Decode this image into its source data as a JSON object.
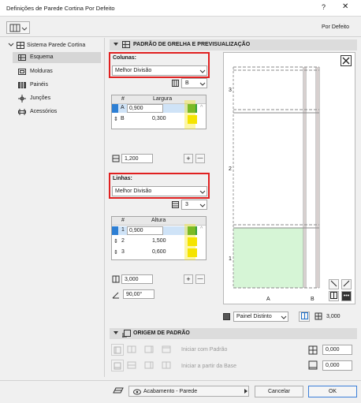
{
  "window": {
    "title": "Definições de Parede Cortina Por Defeito",
    "help": "?",
    "close": "✕"
  },
  "header": {
    "mode": "Por Defeito"
  },
  "sidebar": {
    "root": "Sistema Parede Cortina",
    "items": [
      {
        "label": "Esquema"
      },
      {
        "label": "Molduras"
      },
      {
        "label": "Painéis"
      },
      {
        "label": "Junções"
      },
      {
        "label": "Acessórios"
      }
    ]
  },
  "section_grid": {
    "title": "PADRÃO DE GRELHA E PREVISUALIZAÇÃO"
  },
  "columns": {
    "label": "Colunas:",
    "mode": "Melhor Divisão",
    "ref": "B",
    "table": {
      "hash": "#",
      "header": "Largura",
      "rows": [
        {
          "id": "A",
          "value": "0,900"
        },
        {
          "id": "B",
          "value": "0,300"
        }
      ]
    },
    "total": "1,200",
    "add": "+",
    "remove": "—"
  },
  "rows": {
    "label": "Linhas:",
    "mode": "Melhor Divisão",
    "ref": "3",
    "table": {
      "hash": "#",
      "header": "Altura",
      "rows": [
        {
          "id": "1",
          "value": "0,900"
        },
        {
          "id": "2",
          "value": "1,500"
        },
        {
          "id": "3",
          "value": "0,600"
        }
      ]
    },
    "total": "3,000",
    "add": "+",
    "remove": "—",
    "angle": "90,00°"
  },
  "preview": {
    "col_labels": [
      "A",
      "B"
    ],
    "row_labels": [
      "1",
      "2",
      "3"
    ],
    "panel_select": "Painel Distinto",
    "height": "3,000"
  },
  "section_origin": {
    "title": "ORIGEM DE PADRÃO",
    "start_pattern": "Iniciar com Padrão",
    "start_base": "Iniciar a partir da Base",
    "offset_x": "0,000",
    "offset_y": "0,000"
  },
  "footer": {
    "surface": "Acabamento - Parede",
    "cancel": "Cancelar",
    "ok": "OK"
  }
}
